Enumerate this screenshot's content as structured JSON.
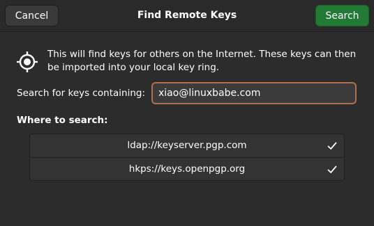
{
  "header": {
    "title": "Find Remote Keys",
    "cancel_label": "Cancel",
    "search_label": "Search",
    "accent_color": "#237a34"
  },
  "info": {
    "icon": "target-icon",
    "text": "This will find keys for others on the Internet. These keys can then be imported into your local key ring."
  },
  "search": {
    "label": "Search for keys containing:",
    "value": "xiao@linuxbabe.com",
    "focus_border_color": "#b26f4f"
  },
  "servers": {
    "label": "Where to search:",
    "items": [
      {
        "name": "ldap://keyserver.pgp.com",
        "checked": true,
        "icon": "checkmark-icon"
      },
      {
        "name": "hkps://keys.openpgp.org",
        "checked": true,
        "icon": "checkmark-icon"
      }
    ]
  }
}
